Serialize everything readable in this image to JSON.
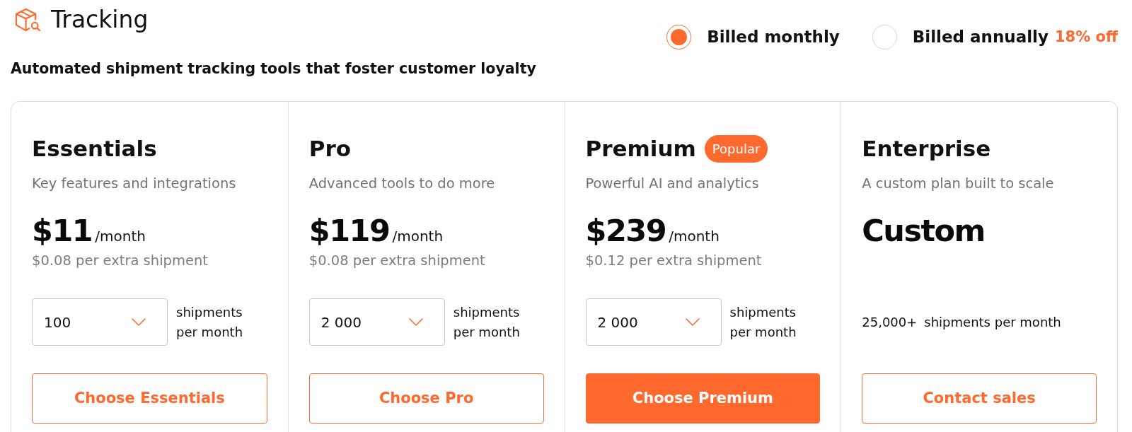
{
  "header": {
    "title": "Tracking",
    "subtitle": "Automated shipment tracking tools that foster customer loyalty"
  },
  "billing": [
    {
      "label": "Billed monthly",
      "selected": true
    },
    {
      "label": "Billed annually",
      "discount": "18% off",
      "selected": false
    }
  ],
  "plans": [
    {
      "kind": "standard",
      "name": "Essentials",
      "description": "Key features and integrations",
      "price": "$11",
      "period": "/month",
      "extra": "$0.08 per extra shipment",
      "shipments": {
        "value": "100",
        "unit": "shipments per month"
      },
      "button": {
        "label": "Choose Essentials",
        "primary": false
      }
    },
    {
      "kind": "standard",
      "name": "Pro",
      "description": "Advanced tools to do more",
      "price": "$119",
      "period": "/month",
      "extra": "$0.08 per extra shipment",
      "shipments": {
        "value": "2 000",
        "unit": "shipments per month"
      },
      "button": {
        "label": "Choose Pro",
        "primary": false
      }
    },
    {
      "kind": "standard",
      "name": "Premium",
      "badge": "Popular",
      "description": "Powerful AI and analytics",
      "price": "$239",
      "period": "/month",
      "extra": "$0.12 per extra shipment",
      "shipments": {
        "value": "2 000",
        "unit": "shipments per month"
      },
      "button": {
        "label": "Choose Premium",
        "primary": true
      }
    },
    {
      "kind": "custom",
      "name": "Enterprise",
      "description": "A custom plan built to scale",
      "price": "Custom",
      "shipments": {
        "value": "25,000+",
        "unit": "shipments per month"
      },
      "button": {
        "label": "Contact sales",
        "primary": false
      }
    }
  ]
}
